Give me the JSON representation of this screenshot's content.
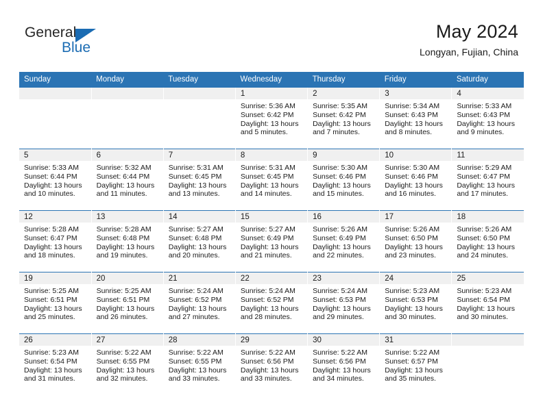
{
  "brand": {
    "name_top": "General",
    "name_bottom": "Blue",
    "accent_color": "#1b6cb3"
  },
  "header": {
    "title": "May 2024",
    "subtitle": "Longyan, Fujian, China"
  },
  "calendar": {
    "header_bg": "#2b74b4",
    "daynum_bg": "#f0f0f0",
    "weekday_names": [
      "Sunday",
      "Monday",
      "Tuesday",
      "Wednesday",
      "Thursday",
      "Friday",
      "Saturday"
    ],
    "labels": {
      "sunrise": "Sunrise:",
      "sunset": "Sunset:",
      "daylight": "Daylight:"
    },
    "weeks": [
      [
        {
          "day": "",
          "blank": true
        },
        {
          "day": "",
          "blank": true
        },
        {
          "day": "",
          "blank": true
        },
        {
          "day": "1",
          "sunrise": "Sunrise: 5:36 AM",
          "sunset": "Sunset: 6:42 PM",
          "daylight": "Daylight: 13 hours and 5 minutes."
        },
        {
          "day": "2",
          "sunrise": "Sunrise: 5:35 AM",
          "sunset": "Sunset: 6:42 PM",
          "daylight": "Daylight: 13 hours and 7 minutes."
        },
        {
          "day": "3",
          "sunrise": "Sunrise: 5:34 AM",
          "sunset": "Sunset: 6:43 PM",
          "daylight": "Daylight: 13 hours and 8 minutes."
        },
        {
          "day": "4",
          "sunrise": "Sunrise: 5:33 AM",
          "sunset": "Sunset: 6:43 PM",
          "daylight": "Daylight: 13 hours and 9 minutes."
        }
      ],
      [
        {
          "day": "5",
          "sunrise": "Sunrise: 5:33 AM",
          "sunset": "Sunset: 6:44 PM",
          "daylight": "Daylight: 13 hours and 10 minutes."
        },
        {
          "day": "6",
          "sunrise": "Sunrise: 5:32 AM",
          "sunset": "Sunset: 6:44 PM",
          "daylight": "Daylight: 13 hours and 11 minutes."
        },
        {
          "day": "7",
          "sunrise": "Sunrise: 5:31 AM",
          "sunset": "Sunset: 6:45 PM",
          "daylight": "Daylight: 13 hours and 13 minutes."
        },
        {
          "day": "8",
          "sunrise": "Sunrise: 5:31 AM",
          "sunset": "Sunset: 6:45 PM",
          "daylight": "Daylight: 13 hours and 14 minutes."
        },
        {
          "day": "9",
          "sunrise": "Sunrise: 5:30 AM",
          "sunset": "Sunset: 6:46 PM",
          "daylight": "Daylight: 13 hours and 15 minutes."
        },
        {
          "day": "10",
          "sunrise": "Sunrise: 5:30 AM",
          "sunset": "Sunset: 6:46 PM",
          "daylight": "Daylight: 13 hours and 16 minutes."
        },
        {
          "day": "11",
          "sunrise": "Sunrise: 5:29 AM",
          "sunset": "Sunset: 6:47 PM",
          "daylight": "Daylight: 13 hours and 17 minutes."
        }
      ],
      [
        {
          "day": "12",
          "sunrise": "Sunrise: 5:28 AM",
          "sunset": "Sunset: 6:47 PM",
          "daylight": "Daylight: 13 hours and 18 minutes."
        },
        {
          "day": "13",
          "sunrise": "Sunrise: 5:28 AM",
          "sunset": "Sunset: 6:48 PM",
          "daylight": "Daylight: 13 hours and 19 minutes."
        },
        {
          "day": "14",
          "sunrise": "Sunrise: 5:27 AM",
          "sunset": "Sunset: 6:48 PM",
          "daylight": "Daylight: 13 hours and 20 minutes."
        },
        {
          "day": "15",
          "sunrise": "Sunrise: 5:27 AM",
          "sunset": "Sunset: 6:49 PM",
          "daylight": "Daylight: 13 hours and 21 minutes."
        },
        {
          "day": "16",
          "sunrise": "Sunrise: 5:26 AM",
          "sunset": "Sunset: 6:49 PM",
          "daylight": "Daylight: 13 hours and 22 minutes."
        },
        {
          "day": "17",
          "sunrise": "Sunrise: 5:26 AM",
          "sunset": "Sunset: 6:50 PM",
          "daylight": "Daylight: 13 hours and 23 minutes."
        },
        {
          "day": "18",
          "sunrise": "Sunrise: 5:26 AM",
          "sunset": "Sunset: 6:50 PM",
          "daylight": "Daylight: 13 hours and 24 minutes."
        }
      ],
      [
        {
          "day": "19",
          "sunrise": "Sunrise: 5:25 AM",
          "sunset": "Sunset: 6:51 PM",
          "daylight": "Daylight: 13 hours and 25 minutes."
        },
        {
          "day": "20",
          "sunrise": "Sunrise: 5:25 AM",
          "sunset": "Sunset: 6:51 PM",
          "daylight": "Daylight: 13 hours and 26 minutes."
        },
        {
          "day": "21",
          "sunrise": "Sunrise: 5:24 AM",
          "sunset": "Sunset: 6:52 PM",
          "daylight": "Daylight: 13 hours and 27 minutes."
        },
        {
          "day": "22",
          "sunrise": "Sunrise: 5:24 AM",
          "sunset": "Sunset: 6:52 PM",
          "daylight": "Daylight: 13 hours and 28 minutes."
        },
        {
          "day": "23",
          "sunrise": "Sunrise: 5:24 AM",
          "sunset": "Sunset: 6:53 PM",
          "daylight": "Daylight: 13 hours and 29 minutes."
        },
        {
          "day": "24",
          "sunrise": "Sunrise: 5:23 AM",
          "sunset": "Sunset: 6:53 PM",
          "daylight": "Daylight: 13 hours and 30 minutes."
        },
        {
          "day": "25",
          "sunrise": "Sunrise: 5:23 AM",
          "sunset": "Sunset: 6:54 PM",
          "daylight": "Daylight: 13 hours and 30 minutes."
        }
      ],
      [
        {
          "day": "26",
          "sunrise": "Sunrise: 5:23 AM",
          "sunset": "Sunset: 6:54 PM",
          "daylight": "Daylight: 13 hours and 31 minutes."
        },
        {
          "day": "27",
          "sunrise": "Sunrise: 5:22 AM",
          "sunset": "Sunset: 6:55 PM",
          "daylight": "Daylight: 13 hours and 32 minutes."
        },
        {
          "day": "28",
          "sunrise": "Sunrise: 5:22 AM",
          "sunset": "Sunset: 6:55 PM",
          "daylight": "Daylight: 13 hours and 33 minutes."
        },
        {
          "day": "29",
          "sunrise": "Sunrise: 5:22 AM",
          "sunset": "Sunset: 6:56 PM",
          "daylight": "Daylight: 13 hours and 33 minutes."
        },
        {
          "day": "30",
          "sunrise": "Sunrise: 5:22 AM",
          "sunset": "Sunset: 6:56 PM",
          "daylight": "Daylight: 13 hours and 34 minutes."
        },
        {
          "day": "31",
          "sunrise": "Sunrise: 5:22 AM",
          "sunset": "Sunset: 6:57 PM",
          "daylight": "Daylight: 13 hours and 35 minutes."
        },
        {
          "day": "",
          "blank": true
        }
      ]
    ]
  }
}
